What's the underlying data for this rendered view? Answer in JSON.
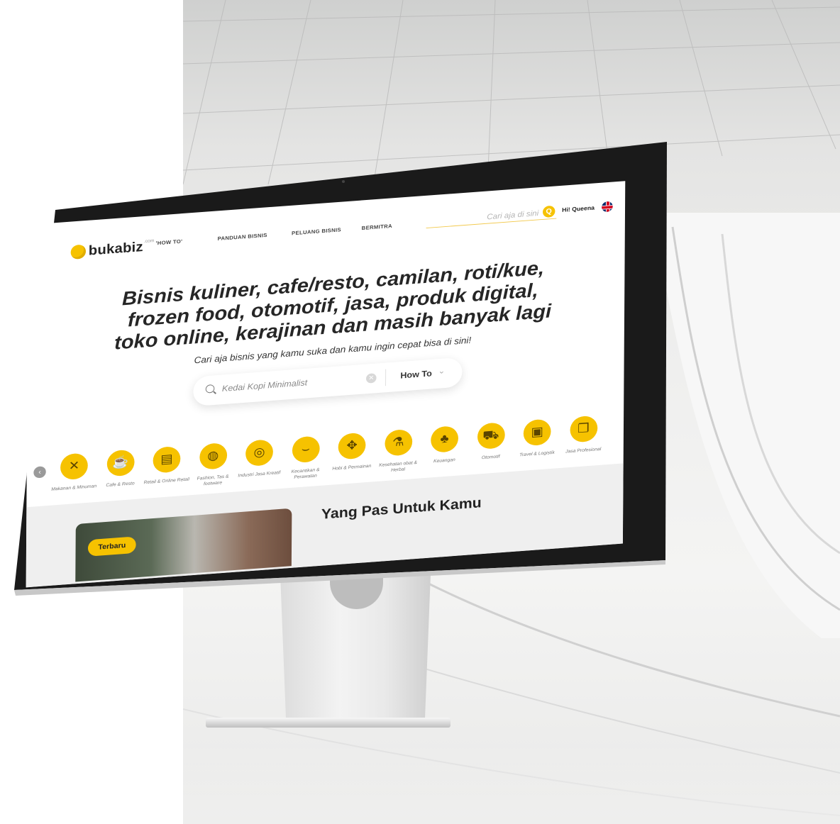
{
  "site": {
    "logo": "bukabiz",
    "logo_suffix": ".com"
  },
  "nav": {
    "items": [
      "'HOW TO'",
      "PANDUAN BISNIS",
      "PELUANG BISNIS",
      "BERMITRA"
    ],
    "search_placeholder": "Cari aja di sini",
    "search_icon": "search-icon",
    "greeting": "Hi! Queena",
    "language_icon": "uk-flag-icon"
  },
  "hero": {
    "title_lines": [
      "Bisnis kuliner, cafe/resto, camilan, roti/kue,",
      "frozen food, otomotif, jasa, produk digital,",
      "toko online, kerajinan dan masih banyak lagi"
    ],
    "subtitle": "Cari aja bisnis yang kamu suka dan kamu ingin cepat bisa di sini!",
    "search_value": "Kedai Kopi Minimalist",
    "dropdown_value": "How To"
  },
  "categories": [
    {
      "label": "Makanan & Minuman",
      "icon": "fork-knife-icon",
      "glyph": "✕"
    },
    {
      "label": "Cafe & Resto",
      "icon": "coffee-cup-icon",
      "glyph": "☕"
    },
    {
      "label": "Retail & Online Retail",
      "icon": "store-icon",
      "glyph": "▤"
    },
    {
      "label": "Fashion, Tas & footware",
      "icon": "shirt-icon",
      "glyph": "◍"
    },
    {
      "label": "Industri Jasa Kreatif",
      "icon": "camera-icon",
      "glyph": "◎"
    },
    {
      "label": "Kecantikan & Perawatan",
      "icon": "eyelash-icon",
      "glyph": "⌣"
    },
    {
      "label": "Hobi & Permainan",
      "icon": "gamepad-icon",
      "glyph": "✥"
    },
    {
      "label": "Kesehatan obat & Herbal",
      "icon": "mortar-icon",
      "glyph": "⚗"
    },
    {
      "label": "Keuangan",
      "icon": "plant-growth-icon",
      "glyph": "♣"
    },
    {
      "label": "Otomotif",
      "icon": "car-icon",
      "glyph": "⛟"
    },
    {
      "label": "Travel & Logistik",
      "icon": "bus-icon",
      "glyph": "▣"
    },
    {
      "label": "Jasa Profesional",
      "icon": "document-icon",
      "glyph": "❐"
    }
  ],
  "section": {
    "title": "Yang Pas Untuk Kamu",
    "card_tag": "Terbaru"
  },
  "colors": {
    "accent": "#f6c200",
    "text": "#262626",
    "bezel": "#1a1a1a"
  }
}
